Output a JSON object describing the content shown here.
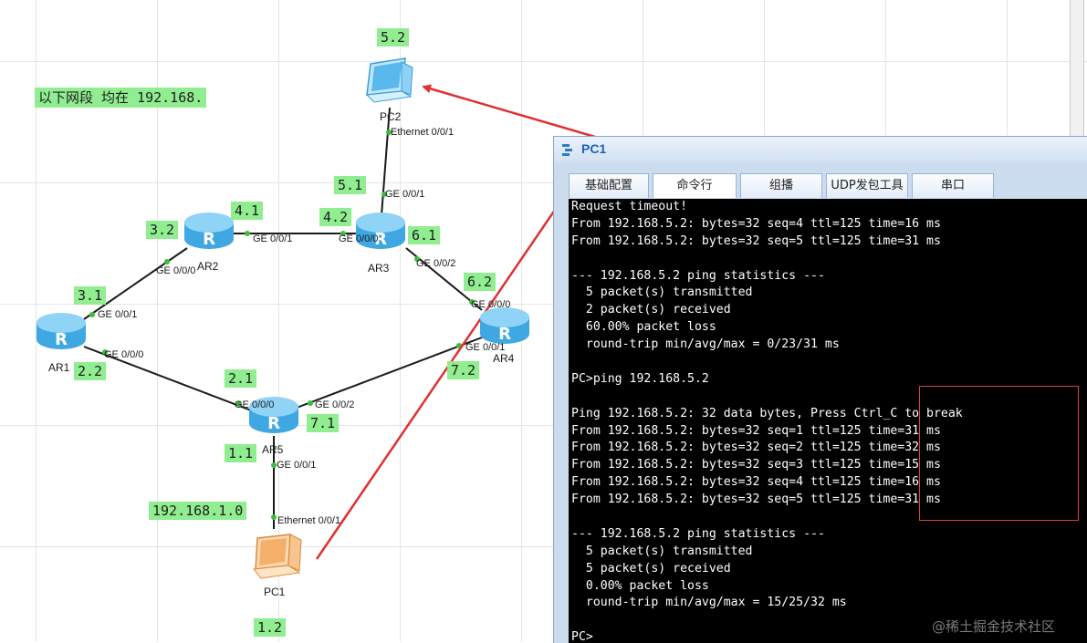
{
  "topology": {
    "note": "以下网段 均在 192.168.",
    "subnet_label": "192.168.1.0",
    "devices": {
      "ar1": "AR1",
      "ar2": "AR2",
      "ar3": "AR3",
      "ar4": "AR4",
      "ar5": "AR5",
      "pc1": "PC1",
      "pc2": "PC2"
    },
    "address_tags": {
      "pc2": "5.2",
      "ar3_up": "5.1",
      "ar2_ar1": "3.2",
      "ar2_ar3": "4.1",
      "ar3_ar2": "4.2",
      "ar3_ar4": "6.1",
      "ar4_ar3": "6.2",
      "ar1_ar2": "3.1",
      "ar1_ar5": "2.2",
      "ar5_ar1": "2.1",
      "ar5_ar4": "7.1",
      "ar4_ar5": "7.2",
      "ar5_pc1": "1.1",
      "pc1": "1.2"
    },
    "ports": {
      "pc2_eth": "Ethernet 0/0/1",
      "ar3_ge001_up": "GE 0/0/1",
      "ar2_ge001": "GE 0/0/1",
      "ar3_ge000": "GE 0/0/0",
      "ar3_ge002": "GE 0/0/2",
      "ar2_ge000": "GE 0/0/0",
      "ar4_ge000": "GE 0/0/0",
      "ar1_ge001": "GE 0/0/1",
      "ar1_ge000": "GE 0/0/0",
      "ar4_ge001": "GE 0/0/1",
      "ar5_ge000": "GE 0/0/0",
      "ar5_ge002": "GE 0/0/2",
      "ar5_ge001": "GE 0/0/1",
      "pc1_eth": "Ethernet 0/0/1"
    }
  },
  "console": {
    "title": "PC1",
    "tabs": [
      "基础配置",
      "命令行",
      "组播",
      "UDP发包工具",
      "串口"
    ],
    "active_tab": "命令行",
    "lines": [
      "Request timeout!",
      "From 192.168.5.2: bytes=32 seq=4 ttl=125 time=16 ms",
      "From 192.168.5.2: bytes=32 seq=5 ttl=125 time=31 ms",
      "",
      "--- 192.168.5.2 ping statistics ---",
      "  5 packet(s) transmitted",
      "  2 packet(s) received",
      "  60.00% packet loss",
      "  round-trip min/avg/max = 0/23/31 ms",
      "",
      "PC>ping 192.168.5.2",
      "",
      "Ping 192.168.5.2: 32 data bytes, Press Ctrl_C to break",
      "From 192.168.5.2: bytes=32 seq=1 ttl=125 time=31 ms",
      "From 192.168.5.2: bytes=32 seq=2 ttl=125 time=32 ms",
      "From 192.168.5.2: bytes=32 seq=3 ttl=125 time=15 ms",
      "From 192.168.5.2: bytes=32 seq=4 ttl=125 time=16 ms",
      "From 192.168.5.2: bytes=32 seq=5 ttl=125 time=31 ms",
      "",
      "--- 192.168.5.2 ping statistics ---",
      "  5 packet(s) transmitted",
      "  5 packet(s) received",
      "  0.00% packet loss",
      "  round-trip min/avg/max = 15/25/32 ms",
      "",
      "PC>"
    ]
  },
  "watermark": "@稀土掘金技术社区",
  "colors": {
    "tag_bg": "#90ee90",
    "arrow": "#e03030",
    "link_dot": "#3bbf3b",
    "router_blue": "#4fb5ea",
    "pc1_orange": "#f0a25a",
    "terminal_bg": "#000000"
  }
}
